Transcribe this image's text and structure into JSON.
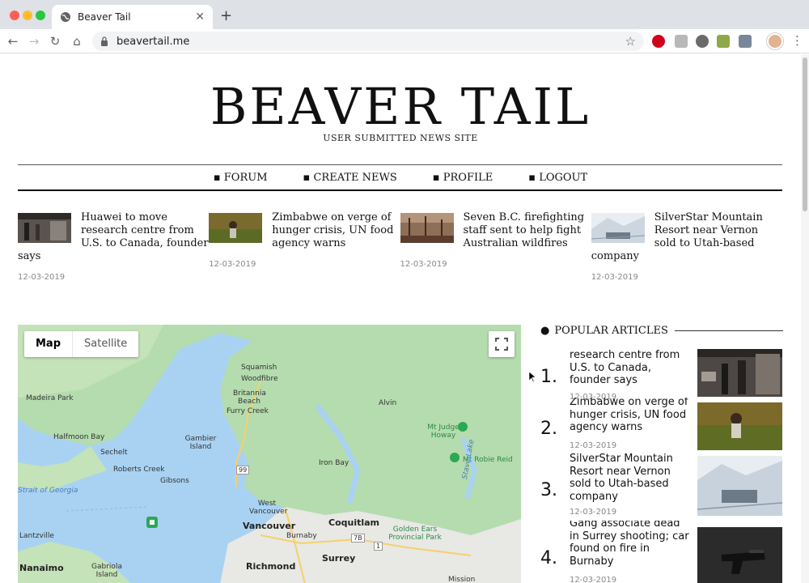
{
  "browser": {
    "tab_title": "Beaver Tail",
    "url": "beavertail.me",
    "colors": {
      "close": "#ff5f57",
      "minimize": "#febc2e",
      "zoom": "#28c840"
    }
  },
  "site": {
    "logo": "BEAVER TAIL",
    "tagline": "USER SUBMITTED NEWS SITE",
    "nav": [
      "FORUM",
      "CREATE NEWS",
      "PROFILE",
      "LOGOUT"
    ]
  },
  "news": [
    {
      "headline": "Huawei to move research centre from U.S. to Canada, founder says",
      "date": "12-03-2019",
      "thumb": "huawei-store-photo"
    },
    {
      "headline": "Zimbabwe on verge of hunger crisis, UN food agency warns",
      "date": "12-03-2019",
      "thumb": "crop-field-photo"
    },
    {
      "headline": "Seven B.C. firefighting staff sent to help fight Australian wildfires",
      "date": "12-03-2019",
      "thumb": "burned-forest-photo"
    },
    {
      "headline": "SilverStar Mountain Resort near Vernon sold to Utah-based company",
      "date": "12-03-2019",
      "thumb": "ski-resort-photo"
    }
  ],
  "map": {
    "toggle": {
      "map": "Map",
      "satellite": "Satellite"
    },
    "labels": {
      "squamish": "Squamish",
      "woodfibre": "Woodfibre",
      "britannia": "Britannia Beach",
      "furry_creek": "Furry Creek",
      "madeira": "Madeira Park",
      "halfmoon": "Halfmoon Bay",
      "sechelt": "Sechelt",
      "gambier": "Gambier Island",
      "roberts": "Roberts Creek",
      "gibsons": "Gibsons",
      "strait": "Strait of Georgia",
      "alvin": "Alvin",
      "judge_howay": "Mt Judge Howay",
      "robie_reid": "Mt Robie Reid",
      "iron_bay": "Iron Bay",
      "stave_lake": "Stave Lake",
      "west_vancouver": "West Vancouver",
      "vancouver": "Vancouver",
      "coquitlam": "Coquitlam",
      "burnaby": "Burnaby",
      "golden_ears": "Golden Ears Provincial Park",
      "surrey": "Surrey",
      "richmond": "Richmond",
      "lantzville": "Lantzville",
      "nanaimo": "Nanaimo",
      "gabriola": "Gabriola Island",
      "mission": "Mission",
      "hwy99": "99",
      "hwy7b": "7B",
      "hwy1": "1"
    }
  },
  "popular": {
    "heading": "POPULAR ARTICLES",
    "items": [
      {
        "num": "1.",
        "headline": "research centre from U.S. to Canada, founder says",
        "date": "12-03-2019",
        "image": "huawei-store-photo"
      },
      {
        "num": "2.",
        "headline": "Zimbabwe on verge of hunger crisis, UN food agency warns",
        "date": "12-03-2019",
        "image": "crop-field-photo"
      },
      {
        "num": "3.",
        "headline": "SilverStar Mountain Resort near Vernon sold to Utah-based company",
        "date": "12-03-2019",
        "image": "ski-resort-photo"
      },
      {
        "num": "4.",
        "headline": "Gang associate dead in Surrey shooting; car found on fire in Burnaby",
        "date": "12-03-2019",
        "image": "handgun-photo"
      }
    ]
  }
}
